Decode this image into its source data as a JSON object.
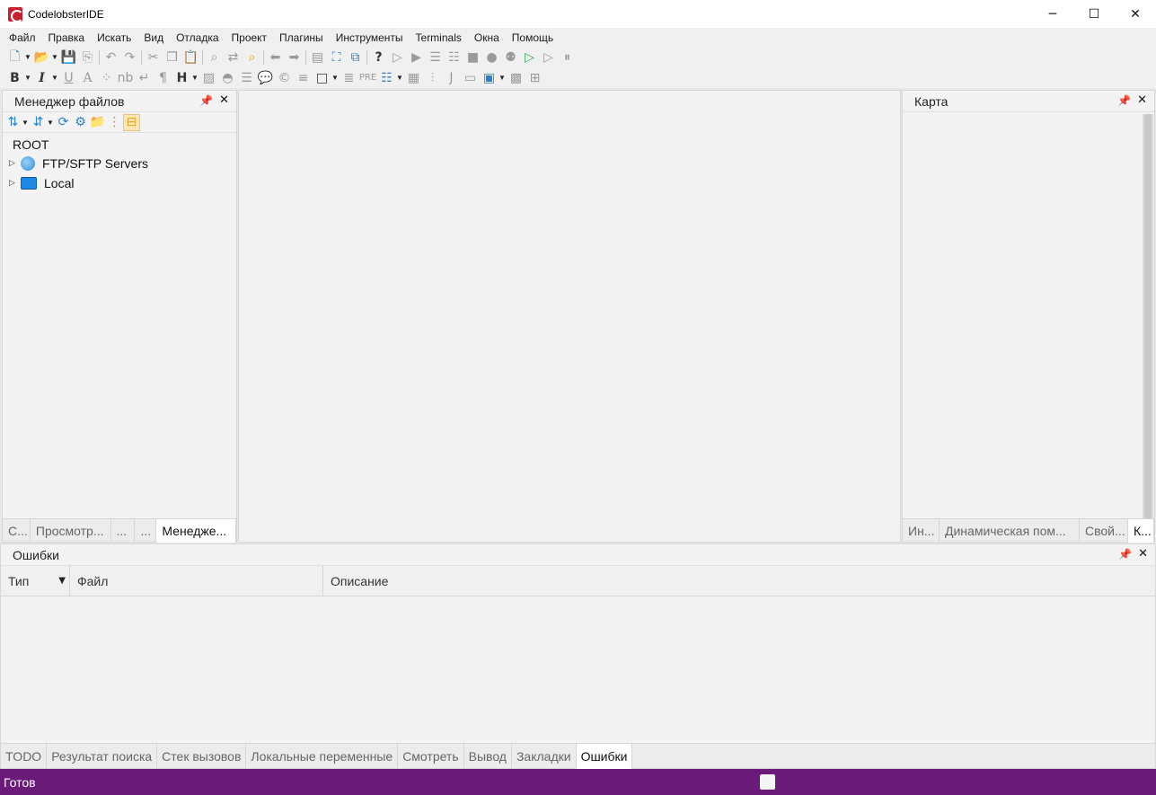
{
  "window": {
    "title": "CodelobsterIDE",
    "minimize": "─",
    "maximize": "☐",
    "close": "✕"
  },
  "menu": [
    "Файл",
    "Правка",
    "Искать",
    "Вид",
    "Отладка",
    "Проект",
    "Плагины",
    "Инструменты",
    "Terminals",
    "Окна",
    "Помощь"
  ],
  "file_manager": {
    "title": "Менеджер файлов",
    "root": "ROOT",
    "nodes": [
      {
        "label": "FTP/SFTP Servers",
        "icon": "globe-icon"
      },
      {
        "label": "Local",
        "icon": "monitor-icon"
      }
    ],
    "tabs": [
      "С...",
      "Просмотр...",
      "...",
      "...",
      "Менедже..."
    ],
    "active_tab": 4
  },
  "map_panel": {
    "title": "Карта",
    "tabs": [
      "Ин...",
      "Динамическая пом...",
      "Свой...",
      "К..."
    ],
    "active_tab": 3
  },
  "errors_panel": {
    "title": "Ошибки",
    "columns": [
      "Тип",
      "Файл",
      "Описание"
    ],
    "rows": [],
    "tabs": [
      "TODO",
      "Результат поиска",
      "Стек вызовов",
      "Локальные переменные",
      "Смотреть",
      "Вывод",
      "Закладки",
      "Ошибки"
    ],
    "active_tab": 7
  },
  "status": {
    "text": "Готов"
  },
  "panel_controls": {
    "pin": "📌",
    "close": "✕"
  },
  "colors": {
    "status_bar": "#6a1b7a",
    "app_icon": "#c8202f"
  }
}
